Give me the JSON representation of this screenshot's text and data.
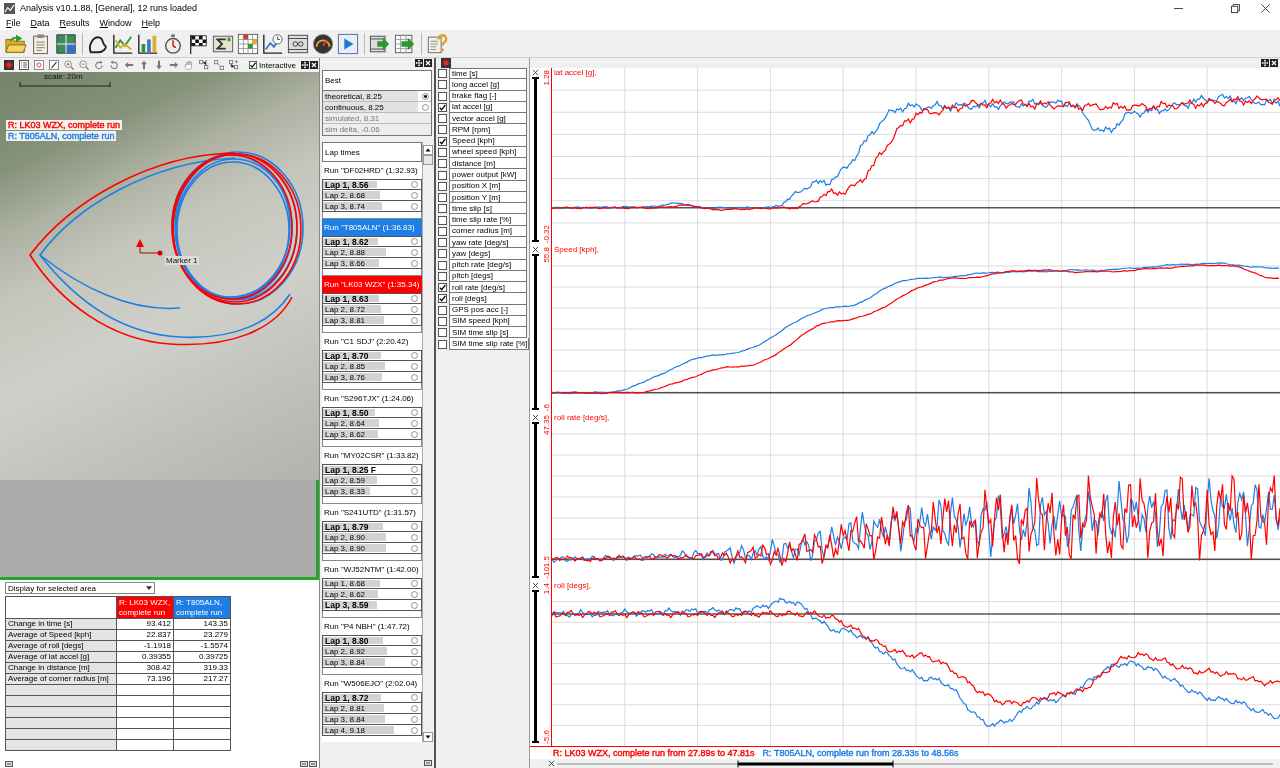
{
  "window": {
    "title": "Analysis v10.1.88, [General], 12 runs loaded"
  },
  "menu": [
    "File",
    "Data",
    "Results",
    "Window",
    "Help"
  ],
  "map_panel": {
    "interactive": {
      "label": "Interactive",
      "checked": true
    },
    "scale": "scale: 20m",
    "legend": [
      {
        "text": "R: LK03 WZX, complete run",
        "color": "#ff0000"
      },
      {
        "text": "R: T805ALN, complete run",
        "color": "#1e7ee6"
      }
    ],
    "marker": "Marker 1"
  },
  "area_stats": {
    "dropdown": "Display for selected area",
    "columns": [
      {
        "text": "R: LK03 WZX, complete run",
        "color": "#ff0000"
      },
      {
        "text": "R: T805ALN, complete run",
        "color": "#1e7ee6"
      }
    ],
    "rows": [
      {
        "label": "Change in time [s]",
        "values": [
          "93.412",
          "143.35"
        ]
      },
      {
        "label": "Average of Speed [kph]",
        "values": [
          "22.837",
          "23.279"
        ]
      },
      {
        "label": "Average of roll [degs]",
        "values": [
          "-1.1918",
          "-1.5574"
        ]
      },
      {
        "label": "Average of lat accel [g]",
        "values": [
          "0.39355",
          "0.39725"
        ]
      },
      {
        "label": "Change in distance [m]",
        "values": [
          "308.42",
          "319.33"
        ]
      },
      {
        "label": "Average of corner radius [m]",
        "values": [
          "73.196",
          "217.27"
        ]
      }
    ]
  },
  "best": {
    "title": "Best",
    "rows": [
      {
        "text": "theoretical, 8.25",
        "kind": "radio",
        "selected": true
      },
      {
        "text": "continuous, 8.25",
        "kind": "radio",
        "selected": false
      },
      {
        "text": "simulated, 8.31",
        "kind": "info"
      },
      {
        "text": "sim delta, -0.06",
        "kind": "info"
      }
    ]
  },
  "lap_times": {
    "title": "Lap times",
    "runs": [
      {
        "title": "Run \"DF02HRD\" (1:32.93)",
        "laps": [
          {
            "text": "Lap 1, 8.56",
            "best": true,
            "level": 0.55,
            "selected": false
          },
          {
            "text": "Lap 2, 8.68",
            "best": false,
            "level": 0.58,
            "selected": false
          },
          {
            "text": "Lap 3, 8.74",
            "best": false,
            "level": 0.6,
            "selected": false
          }
        ]
      },
      {
        "title": "Run \"T805ALN\" (1:36.83)",
        "color": "#1e7ee6",
        "laps": [
          {
            "text": "Lap 1, 8.62",
            "best": true,
            "level": 0.56,
            "selected": false
          },
          {
            "text": "Lap 2, 8.88",
            "best": false,
            "level": 0.64,
            "selected": false
          },
          {
            "text": "Lap 3, 8.66",
            "best": false,
            "level": 0.57,
            "selected": false
          }
        ]
      },
      {
        "title": "Run \"LK03 WZX\" (1:35.34)",
        "color": "#ff0000",
        "laps": [
          {
            "text": "Lap 1, 8.63",
            "best": true,
            "level": 0.57,
            "selected": false
          },
          {
            "text": "Lap 2, 8.72",
            "best": false,
            "level": 0.59,
            "selected": false
          },
          {
            "text": "Lap 3, 8.81",
            "best": false,
            "level": 0.62,
            "selected": false
          }
        ]
      },
      {
        "title": "Run \"C1 SDJ\" (2:20.42)",
        "laps": [
          {
            "text": "Lap 1, 8.70",
            "best": true,
            "level": 0.59,
            "selected": false
          },
          {
            "text": "Lap 2, 8.85",
            "best": false,
            "level": 0.63,
            "selected": false
          },
          {
            "text": "Lap 3, 8.76",
            "best": false,
            "level": 0.6,
            "selected": false
          }
        ]
      },
      {
        "title": "Run \"S296TJX\" (1:24.06)",
        "laps": [
          {
            "text": "Lap 1, 8.50",
            "best": true,
            "level": 0.53,
            "selected": false
          },
          {
            "text": "Lap 2, 8.64",
            "best": false,
            "level": 0.57,
            "selected": false
          },
          {
            "text": "Lap 3, 8.62",
            "best": false,
            "level": 0.56,
            "selected": false
          }
        ]
      },
      {
        "title": "Run \"MY02CSR\" (1:33.82)",
        "laps": [
          {
            "text": "Lap 1, 8.25 F",
            "best": true,
            "level": 0.46,
            "selected": false
          },
          {
            "text": "Lap 2, 8.59",
            "best": false,
            "level": 0.55,
            "selected": false
          },
          {
            "text": "Lap 3, 8.33",
            "best": false,
            "level": 0.48,
            "selected": false
          }
        ]
      },
      {
        "title": "Run \"S241UTD\" (1:31.57)",
        "laps": [
          {
            "text": "Lap 1, 8.79",
            "best": true,
            "level": 0.61,
            "selected": false
          },
          {
            "text": "Lap 2, 8.90",
            "best": false,
            "level": 0.64,
            "selected": false
          },
          {
            "text": "Lap 3, 8.90",
            "best": false,
            "level": 0.64,
            "selected": false
          }
        ]
      },
      {
        "title": "Run \"WJ52NTM\" (1:42.00)",
        "laps": [
          {
            "text": "Lap 1, 8.68",
            "best": false,
            "level": 0.58,
            "selected": false
          },
          {
            "text": "Lap 2, 8.62",
            "best": false,
            "level": 0.56,
            "selected": false
          },
          {
            "text": "Lap 3, 8.59",
            "best": true,
            "level": 0.55,
            "selected": false
          }
        ]
      },
      {
        "title": "Run \"P4 NBH\" (1:47.72)",
        "laps": [
          {
            "text": "Lap 1, 8.80",
            "best": true,
            "level": 0.61,
            "selected": false
          },
          {
            "text": "Lap 2, 8.92",
            "best": false,
            "level": 0.65,
            "selected": false
          },
          {
            "text": "Lap 3, 8.84",
            "best": false,
            "level": 0.63,
            "selected": false
          }
        ]
      },
      {
        "title": "Run \"W506EJO\" (2:02.04)",
        "laps": [
          {
            "text": "Lap 1, 8.72",
            "best": true,
            "level": 0.59,
            "selected": false
          },
          {
            "text": "Lap 2, 8.81",
            "best": false,
            "level": 0.62,
            "selected": false
          },
          {
            "text": "Lap 3, 8.84",
            "best": false,
            "level": 0.63,
            "selected": false
          },
          {
            "text": "Lap 4, 9.18",
            "best": false,
            "level": 0.72,
            "selected": false
          }
        ]
      }
    ]
  },
  "channels": [
    {
      "name": "time [s]",
      "checked": false
    },
    {
      "name": "long accel [g]",
      "checked": false
    },
    {
      "name": "brake flag [-]",
      "checked": false
    },
    {
      "name": "lat accel [g]",
      "checked": true
    },
    {
      "name": "vector accel [g]",
      "checked": false
    },
    {
      "name": "RPM [rpm]",
      "checked": false
    },
    {
      "name": "Speed [kph]",
      "checked": true
    },
    {
      "name": "wheel speed [kph]",
      "checked": false
    },
    {
      "name": "distance [m]",
      "checked": false
    },
    {
      "name": "power output [kW]",
      "checked": false
    },
    {
      "name": "position X [m]",
      "checked": false
    },
    {
      "name": "position Y [m]",
      "checked": false
    },
    {
      "name": "time slip [s]",
      "checked": false
    },
    {
      "name": "time slip rate [%]",
      "checked": false
    },
    {
      "name": "corner radius [m]",
      "checked": false
    },
    {
      "name": "yaw rate [deg/s]",
      "checked": false
    },
    {
      "name": "yaw [degs]",
      "checked": false
    },
    {
      "name": "pitch rate [deg/s]",
      "checked": false
    },
    {
      "name": "pitch [degs]",
      "checked": false
    },
    {
      "name": "roll rate [deg/s]",
      "checked": true
    },
    {
      "name": "roll [degs]",
      "checked": true
    },
    {
      "name": "GPS pos acc [-]",
      "checked": false
    },
    {
      "name": "SIM speed [kph]",
      "checked": false
    },
    {
      "name": "SIM time slip [s]",
      "checked": false
    },
    {
      "name": "SIM time slip rate [%]",
      "checked": false
    }
  ],
  "charts": {
    "panes": [
      {
        "title": "lat accel [g],",
        "max": "1.28",
        "min": "-0.32"
      },
      {
        "title": "Speed [kph],",
        "max": "55.8",
        "min": "-6"
      },
      {
        "title": "roll rate [deg/s],",
        "max": "47.35",
        "min": "-101.5"
      },
      {
        "title": "roll [degs],",
        "max": "1.4",
        "min": "-5.6"
      }
    ],
    "status": [
      {
        "text": "R: LK03 WZX, complete run from 27.89s to 47.81s",
        "color": "#ff0000"
      },
      {
        "text": "R: T805ALN, complete run from 28.33s to 48.56s",
        "color": "#1e7ee6"
      }
    ]
  }
}
